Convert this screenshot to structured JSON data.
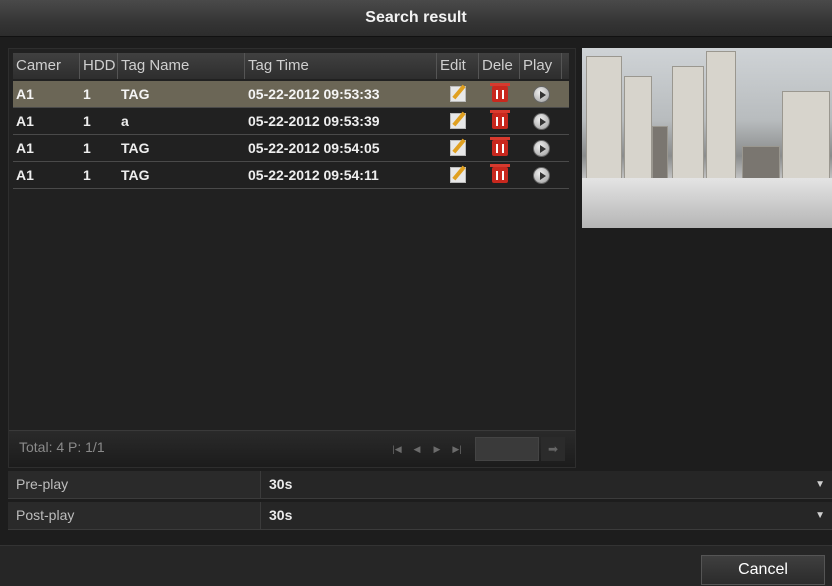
{
  "dialog": {
    "title": "Search result"
  },
  "table": {
    "headers": [
      "Camer",
      "HDD",
      "Tag Name",
      "Tag Time",
      "Edit",
      "Dele",
      "Play"
    ],
    "rows": [
      {
        "camera": "A1",
        "hdd": "1",
        "tag_name": "TAG",
        "tag_time": "05-22-2012 09:53:33",
        "selected": true
      },
      {
        "camera": "A1",
        "hdd": "1",
        "tag_name": "a",
        "tag_time": "05-22-2012 09:53:39",
        "selected": false
      },
      {
        "camera": "A1",
        "hdd": "1",
        "tag_name": "TAG",
        "tag_time": "05-22-2012 09:54:05",
        "selected": false
      },
      {
        "camera": "A1",
        "hdd": "1",
        "tag_name": "TAG",
        "tag_time": "05-22-2012 09:54:11",
        "selected": false
      }
    ]
  },
  "footer": {
    "total_text": "Total: 4  P: 1/1",
    "pager": {
      "first": "|◀",
      "prev": "◀",
      "next": "▶",
      "last": "▶|",
      "go": "➡"
    },
    "page_input": ""
  },
  "settings": {
    "pre_play": {
      "label": "Pre-play",
      "value": "30s"
    },
    "post_play": {
      "label": "Post-play",
      "value": "30s"
    }
  },
  "buttons": {
    "cancel": "Cancel"
  },
  "icons": {
    "edit": "edit-icon",
    "delete": "delete-icon",
    "play": "play-icon",
    "dropdown": "chevron-down-icon"
  },
  "colors": {
    "selected_row": "#6b6656",
    "delete_icon": "#c8281e",
    "edit_icon": "#e0a020"
  }
}
